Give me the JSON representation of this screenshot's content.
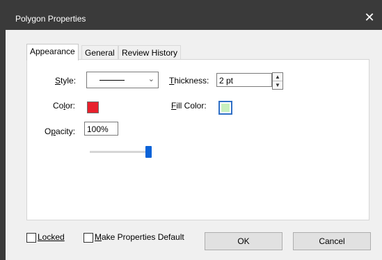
{
  "window": {
    "title": "Polygon Properties",
    "close_glyph": "✕"
  },
  "tabs": [
    {
      "label": "Appearance",
      "active": true
    },
    {
      "label": "General",
      "active": false
    },
    {
      "label": "Review History",
      "active": false
    }
  ],
  "appearance": {
    "style": {
      "label": "Style:",
      "value": "solid line"
    },
    "thickness": {
      "label": "Thickness:",
      "value": "2 pt"
    },
    "color": {
      "label": "Color:",
      "value": "#e8202c"
    },
    "fill_color": {
      "label": "Fill Color:",
      "value": "#c8f0be"
    },
    "opacity": {
      "label": "Opacity:",
      "value": "100%",
      "slider_level": 1.0
    }
  },
  "footer": {
    "locked_label": "Locked",
    "make_default_label": "Make Properties Default",
    "ok_label": "OK",
    "cancel_label": "Cancel"
  },
  "colors": {
    "titlebar": "#3a3a3a",
    "accent": "#0a63d8"
  }
}
